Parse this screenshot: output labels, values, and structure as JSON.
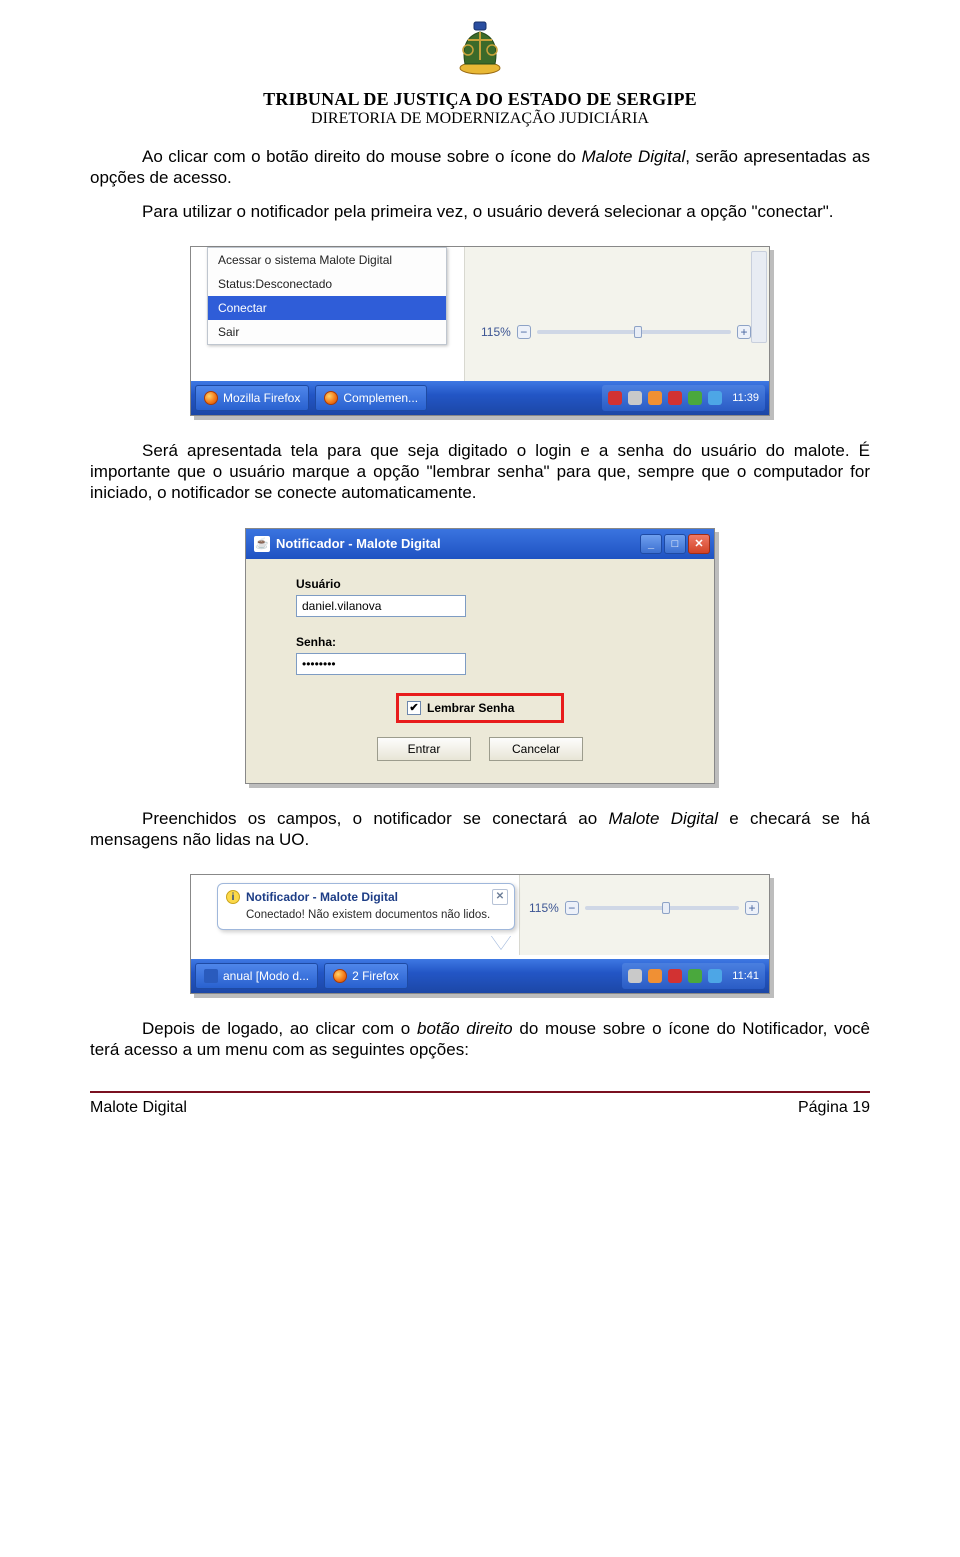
{
  "header": {
    "line1": "TRIBUNAL DE JUSTIÇA DO ESTADO DE SERGIPE",
    "line2": "DIRETORIA DE MODERNIZAÇÃO JUDICIÁRIA"
  },
  "paragraphs": {
    "p1a": "Ao clicar com o botão direito do mouse sobre o ícone do ",
    "p1b": "Malote Digital",
    "p1c": ", serão apresentadas as opções de acesso.",
    "p2": "Para utilizar o notificador pela primeira vez, o usuário deverá selecionar a opção \"conectar\".",
    "p3": "Será apresentada tela para que seja digitado o login e a senha do usuário do malote. É importante que o usuário marque a opção \"lembrar senha\" para que, sempre que o computador for iniciado, o notificador se conecte automaticamente.",
    "p4a": "Preenchidos os campos, o notificador se conectará ao ",
    "p4b": "Malote Digital",
    "p4c": " e checará se há mensagens não lidas na UO.",
    "p5a": "Depois de logado, ao clicar com o ",
    "p5b": "botão direito",
    "p5c": " do mouse sobre o ícone do Notificador, você terá acesso a um menu com as seguintes opções:"
  },
  "shot1": {
    "menu": {
      "item_access": "Acessar o sistema Malote Digital",
      "item_status": "Status:Desconectado",
      "item_connect": "Conectar",
      "item_exit": "Sair"
    },
    "zoom": {
      "value": "115%"
    },
    "taskbar": {
      "btn1": "Mozilla Firefox",
      "btn2": "Complemen...",
      "clock": "11:39"
    }
  },
  "shot2": {
    "title": "Notificador - Malote Digital",
    "label_user": "Usuário",
    "value_user": "daniel.vilanova",
    "label_pass": "Senha:",
    "value_pass": "••••••••",
    "remember": "Lembrar Senha",
    "check_glyph": "✔",
    "btn_enter": "Entrar",
    "btn_cancel": "Cancelar"
  },
  "shot3": {
    "tooltip_title": "Notificador - Malote Digital",
    "tooltip_body": "Conectado! Não existem documentos não lidos.",
    "zoom": {
      "value": "115%"
    },
    "taskbar": {
      "btn1": "anual [Modo d...",
      "btn2": "2 Firefox",
      "clock": "11:41"
    }
  },
  "footer": {
    "left": "Malote Digital",
    "right": "Página 19"
  }
}
